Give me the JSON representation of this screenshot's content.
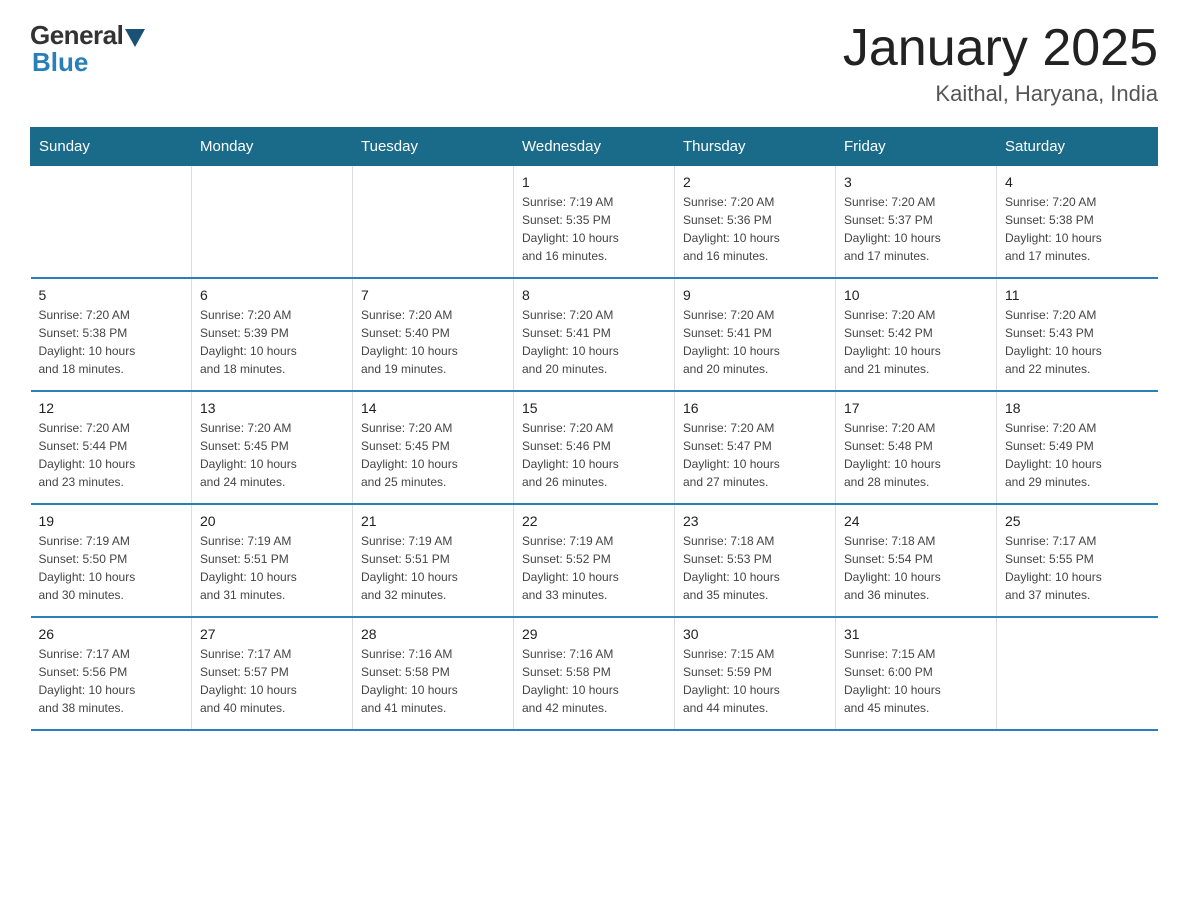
{
  "logo": {
    "general": "General",
    "blue": "Blue"
  },
  "title": "January 2025",
  "subtitle": "Kaithal, Haryana, India",
  "headers": [
    "Sunday",
    "Monday",
    "Tuesday",
    "Wednesday",
    "Thursday",
    "Friday",
    "Saturday"
  ],
  "weeks": [
    [
      {
        "day": "",
        "info": ""
      },
      {
        "day": "",
        "info": ""
      },
      {
        "day": "",
        "info": ""
      },
      {
        "day": "1",
        "info": "Sunrise: 7:19 AM\nSunset: 5:35 PM\nDaylight: 10 hours\nand 16 minutes."
      },
      {
        "day": "2",
        "info": "Sunrise: 7:20 AM\nSunset: 5:36 PM\nDaylight: 10 hours\nand 16 minutes."
      },
      {
        "day": "3",
        "info": "Sunrise: 7:20 AM\nSunset: 5:37 PM\nDaylight: 10 hours\nand 17 minutes."
      },
      {
        "day": "4",
        "info": "Sunrise: 7:20 AM\nSunset: 5:38 PM\nDaylight: 10 hours\nand 17 minutes."
      }
    ],
    [
      {
        "day": "5",
        "info": "Sunrise: 7:20 AM\nSunset: 5:38 PM\nDaylight: 10 hours\nand 18 minutes."
      },
      {
        "day": "6",
        "info": "Sunrise: 7:20 AM\nSunset: 5:39 PM\nDaylight: 10 hours\nand 18 minutes."
      },
      {
        "day": "7",
        "info": "Sunrise: 7:20 AM\nSunset: 5:40 PM\nDaylight: 10 hours\nand 19 minutes."
      },
      {
        "day": "8",
        "info": "Sunrise: 7:20 AM\nSunset: 5:41 PM\nDaylight: 10 hours\nand 20 minutes."
      },
      {
        "day": "9",
        "info": "Sunrise: 7:20 AM\nSunset: 5:41 PM\nDaylight: 10 hours\nand 20 minutes."
      },
      {
        "day": "10",
        "info": "Sunrise: 7:20 AM\nSunset: 5:42 PM\nDaylight: 10 hours\nand 21 minutes."
      },
      {
        "day": "11",
        "info": "Sunrise: 7:20 AM\nSunset: 5:43 PM\nDaylight: 10 hours\nand 22 minutes."
      }
    ],
    [
      {
        "day": "12",
        "info": "Sunrise: 7:20 AM\nSunset: 5:44 PM\nDaylight: 10 hours\nand 23 minutes."
      },
      {
        "day": "13",
        "info": "Sunrise: 7:20 AM\nSunset: 5:45 PM\nDaylight: 10 hours\nand 24 minutes."
      },
      {
        "day": "14",
        "info": "Sunrise: 7:20 AM\nSunset: 5:45 PM\nDaylight: 10 hours\nand 25 minutes."
      },
      {
        "day": "15",
        "info": "Sunrise: 7:20 AM\nSunset: 5:46 PM\nDaylight: 10 hours\nand 26 minutes."
      },
      {
        "day": "16",
        "info": "Sunrise: 7:20 AM\nSunset: 5:47 PM\nDaylight: 10 hours\nand 27 minutes."
      },
      {
        "day": "17",
        "info": "Sunrise: 7:20 AM\nSunset: 5:48 PM\nDaylight: 10 hours\nand 28 minutes."
      },
      {
        "day": "18",
        "info": "Sunrise: 7:20 AM\nSunset: 5:49 PM\nDaylight: 10 hours\nand 29 minutes."
      }
    ],
    [
      {
        "day": "19",
        "info": "Sunrise: 7:19 AM\nSunset: 5:50 PM\nDaylight: 10 hours\nand 30 minutes."
      },
      {
        "day": "20",
        "info": "Sunrise: 7:19 AM\nSunset: 5:51 PM\nDaylight: 10 hours\nand 31 minutes."
      },
      {
        "day": "21",
        "info": "Sunrise: 7:19 AM\nSunset: 5:51 PM\nDaylight: 10 hours\nand 32 minutes."
      },
      {
        "day": "22",
        "info": "Sunrise: 7:19 AM\nSunset: 5:52 PM\nDaylight: 10 hours\nand 33 minutes."
      },
      {
        "day": "23",
        "info": "Sunrise: 7:18 AM\nSunset: 5:53 PM\nDaylight: 10 hours\nand 35 minutes."
      },
      {
        "day": "24",
        "info": "Sunrise: 7:18 AM\nSunset: 5:54 PM\nDaylight: 10 hours\nand 36 minutes."
      },
      {
        "day": "25",
        "info": "Sunrise: 7:17 AM\nSunset: 5:55 PM\nDaylight: 10 hours\nand 37 minutes."
      }
    ],
    [
      {
        "day": "26",
        "info": "Sunrise: 7:17 AM\nSunset: 5:56 PM\nDaylight: 10 hours\nand 38 minutes."
      },
      {
        "day": "27",
        "info": "Sunrise: 7:17 AM\nSunset: 5:57 PM\nDaylight: 10 hours\nand 40 minutes."
      },
      {
        "day": "28",
        "info": "Sunrise: 7:16 AM\nSunset: 5:58 PM\nDaylight: 10 hours\nand 41 minutes."
      },
      {
        "day": "29",
        "info": "Sunrise: 7:16 AM\nSunset: 5:58 PM\nDaylight: 10 hours\nand 42 minutes."
      },
      {
        "day": "30",
        "info": "Sunrise: 7:15 AM\nSunset: 5:59 PM\nDaylight: 10 hours\nand 44 minutes."
      },
      {
        "day": "31",
        "info": "Sunrise: 7:15 AM\nSunset: 6:00 PM\nDaylight: 10 hours\nand 45 minutes."
      },
      {
        "day": "",
        "info": ""
      }
    ]
  ]
}
